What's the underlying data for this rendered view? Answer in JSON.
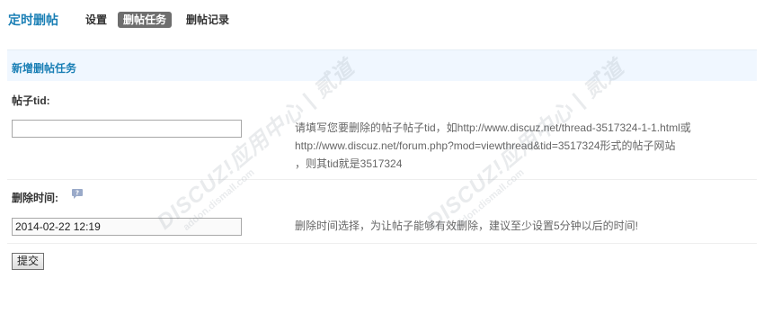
{
  "header": {
    "title": "定时删帖",
    "tabs": [
      {
        "label": "设置",
        "active": false
      },
      {
        "label": "删帖任务",
        "active": true
      },
      {
        "label": "删帖记录",
        "active": false
      }
    ]
  },
  "panel": {
    "title": "新增删帖任务"
  },
  "form": {
    "tid": {
      "label": "帖子tid:",
      "value": "",
      "hint_lines": [
        "请填写您要删除的帖子帖子tid，如http://www.discuz.net/thread-3517324-1-1.html或",
        "http://www.discuz.net/forum.php?mod=viewthread&tid=3517324形式的帖子网站",
        "，则其tid就是3517324"
      ]
    },
    "delete_time": {
      "label": "删除时间:",
      "value": "2014-02-22 12:19",
      "hint": "删除时间选择，为让帖子能够有效删除，建议至少设置5分钟以后的时间!"
    },
    "submit_label": "提交"
  },
  "watermark": {
    "main": "DISCUZ!应用中心 | 贰道",
    "sub": "addon.dismall.com"
  },
  "colors": {
    "accent": "#1a7fb5",
    "active_tab_bg": "#6e6e6e",
    "panel_header_bg": "#f0f7ff"
  }
}
